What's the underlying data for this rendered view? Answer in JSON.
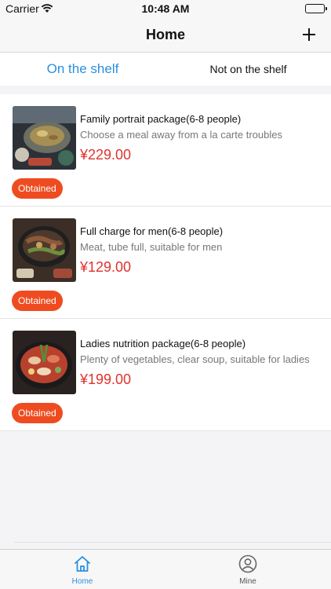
{
  "status_bar": {
    "carrier": "Carrier",
    "time": "10:48 AM"
  },
  "nav": {
    "title": "Home",
    "add_icon": "plus-icon"
  },
  "tabs": [
    {
      "label": "On the shelf",
      "active": true
    },
    {
      "label": "Not on the shelf",
      "active": false
    }
  ],
  "packages": [
    {
      "title": "Family portrait package(6-8 people)",
      "description": "Choose a meal away from a la carte troubles",
      "price": "¥229.00",
      "status": "Obtained"
    },
    {
      "title": "Full charge for men(6-8 people)",
      "description": "Meat, tube full, suitable for men",
      "price": "¥129.00",
      "status": "Obtained"
    },
    {
      "title": "Ladies nutrition package(6-8 people)",
      "description": "Plenty of vegetables, clear soup, suitable for ladies",
      "price": "¥199.00",
      "status": "Obtained"
    }
  ],
  "tab_bar": [
    {
      "label": "Home",
      "icon": "home-icon",
      "active": true
    },
    {
      "label": "Mine",
      "icon": "user-icon",
      "active": false
    }
  ],
  "colors": {
    "accent_blue": "#2a8fdf",
    "price_red": "#e2312d",
    "badge_orange": "#ee4c20"
  }
}
